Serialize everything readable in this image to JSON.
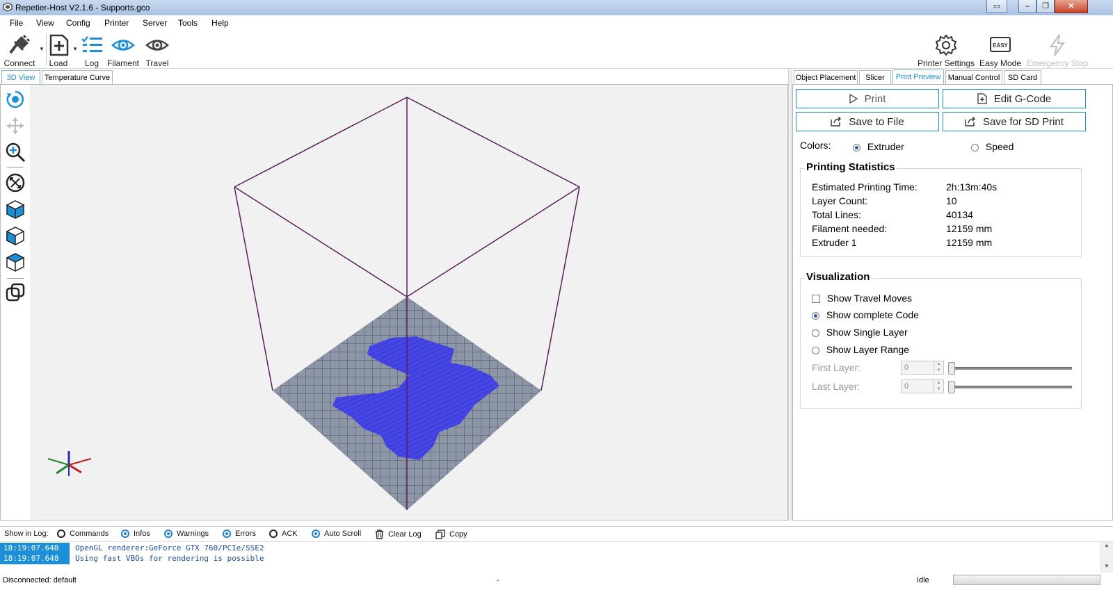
{
  "window": {
    "title": "Repetier-Host V2.1.6 - Supports.gco"
  },
  "menu": [
    "File",
    "View",
    "Config",
    "Printer",
    "Server",
    "Tools",
    "Help"
  ],
  "toolbar": {
    "connect": "Connect",
    "load": "Load",
    "log": "Log",
    "filament": "Filament",
    "travel": "Travel",
    "printer_settings": "Printer Settings",
    "easy_mode": "Easy Mode",
    "easy_badge": "EASY",
    "emergency_stop": "Emergency Stop"
  },
  "left_tabs": [
    "3D View",
    "Temperature Curve"
  ],
  "right_tabs": [
    "Object Placement",
    "Slicer",
    "Print Preview",
    "Manual Control",
    "SD Card"
  ],
  "actions": {
    "print": "Print",
    "edit_gcode": "Edit G-Code",
    "save_file": "Save to File",
    "save_sd": "Save for SD Print"
  },
  "colors_row": {
    "label": "Colors:",
    "extruder": "Extruder",
    "speed": "Speed",
    "selected": "Extruder"
  },
  "stats": {
    "title": "Printing Statistics",
    "rows": [
      {
        "label": "Estimated Printing Time:",
        "value": "2h:13m:40s"
      },
      {
        "label": "Layer Count:",
        "value": "10"
      },
      {
        "label": "Total Lines:",
        "value": "40134"
      },
      {
        "label": "Filament needed:",
        "value": "12159 mm"
      },
      {
        "label": "Extruder 1",
        "value": "12159 mm"
      }
    ]
  },
  "visualization": {
    "title": "Visualization",
    "show_travel": "Show Travel Moves",
    "show_complete": "Show complete Code",
    "show_single": "Show Single Layer",
    "show_range": "Show Layer Range",
    "selected": "Show complete Code",
    "first_layer": "First Layer:",
    "last_layer": "Last Layer:",
    "first_value": "0",
    "last_value": "0"
  },
  "log": {
    "show_in_log": "Show in Log:",
    "options": [
      {
        "label": "Commands",
        "on": false
      },
      {
        "label": "Infos",
        "on": true
      },
      {
        "label": "Warnings",
        "on": true
      },
      {
        "label": "Errors",
        "on": true
      },
      {
        "label": "ACK",
        "on": false
      },
      {
        "label": "Auto Scroll",
        "on": true
      }
    ],
    "clear": "Clear Log",
    "copy": "Copy",
    "entries": [
      {
        "time": "18:19:07.648",
        "msg": "OpenGL renderer:GeForce GTX 760/PCIe/SSE2"
      },
      {
        "time": "18:19:07.648",
        "msg": "Using fast VBOs for rendering is possible"
      }
    ]
  },
  "status": {
    "connection": "Disconnected: default",
    "middle": "-",
    "state": "Idle"
  },
  "colors": {
    "accent": "#1c8fd6",
    "model": "#4646e6",
    "frame": "#5a1f5a",
    "bed": "#8c96a6"
  }
}
